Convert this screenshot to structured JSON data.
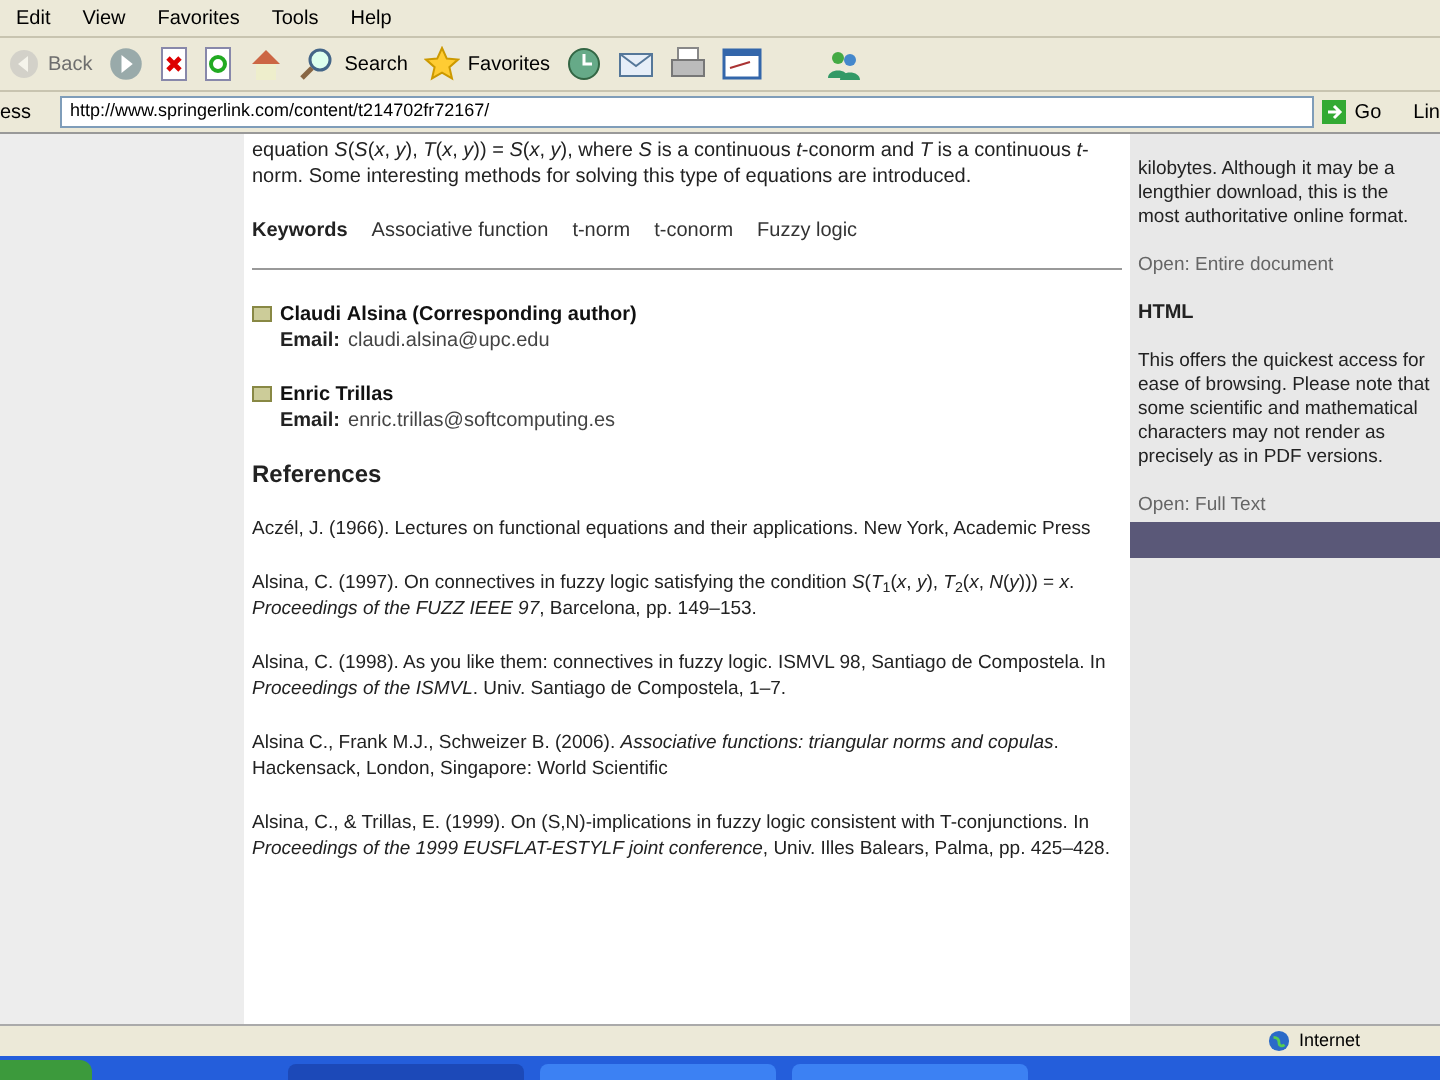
{
  "menu_bar": [
    "Edit",
    "View",
    "Favorites",
    "Tools",
    "Help"
  ],
  "toolbar": [
    {
      "kind": "back",
      "label": "Back",
      "disabled": true
    },
    {
      "kind": "forward",
      "disabled": false
    },
    {
      "kind": "stop"
    },
    {
      "kind": "refresh"
    },
    {
      "kind": "home"
    },
    {
      "kind": "search",
      "label": "Search"
    },
    {
      "kind": "favorites",
      "label": "Favorites"
    },
    {
      "kind": "history"
    },
    {
      "kind": "mail"
    },
    {
      "kind": "print"
    },
    {
      "kind": "edit"
    },
    {
      "kind": "messenger"
    }
  ],
  "address_bar": {
    "label": "ess",
    "value": "http://www.springerlink.com/content/t214702fr72167/",
    "go": "Go",
    "links": "Lin"
  },
  "article": {
    "abstract": "equation *S*(*S*(*x*, *y*), *T*(*x*, *y*)) = *S*(*x*, *y*), where *S* is a continuous *t*-conorm and *T* is a continuous *t*-norm. Some interesting methods for solving this type of equations are introduced.",
    "keywords_label": "Keywords",
    "keywords": [
      "Associative function",
      "t-norm",
      "t-conorm",
      "Fuzzy logic"
    ],
    "authors": [
      {
        "name": "Claudi **Alsina** (Corresponding author)",
        "email_label": "Email:",
        "email": "claudi.alsina@upc.edu"
      },
      {
        "name": "Enric Trillas",
        "email_label": "Email:",
        "email": "enric.trillas@softcomputing.es"
      }
    ],
    "references_title": "References",
    "references": [
      "Aczél, J. (1966). Lectures on functional equations and their applications. New York, Academic Press",
      "Alsina, C. (1997). On connectives in fuzzy logic satisfying the condition *S*(*T*$_{1}$(*x*, *y*), *T*$_{2}$(*x*, *N*(*y*))) = *x*. *Proceedings of the FUZZ IEEE 97*, Barcelona, pp. 149–153.",
      "Alsina, C. (1998). As you like them: connectives in fuzzy logic. ISMVL 98, Santiago de Compostela. In *Proceedings of the ISMVL*. Univ. Santiago de Compostela, 1–7.",
      "Alsina C., Frank M.J., Schweizer B. (2006). *Associative functions: triangular norms and copulas*. Hackensack, London, Singapore: World Scientific",
      "Alsina, C., & Trillas, E. (1999). On (S,N)-implications in fuzzy logic consistent with T-conjunctions. In *Proceedings of the 1999 EUSFLAT-ESTYLF joint conference*, Univ. Illes Balears, Palma, pp. 425–428."
    ]
  },
  "sidebar": {
    "pdf_text": "kilobytes. Although it may be a lengthier download, this is the most authoritative online format.",
    "pdf_link": "Open: Entire document",
    "html_title": "HTML",
    "html_text": "This offers the quickest access for ease of browsing. Please note that some scientific and mathematical characters may not render as precisely as in PDF versions.",
    "html_link": "Open: Full Text"
  },
  "status_bar": {
    "zone": "Internet"
  }
}
